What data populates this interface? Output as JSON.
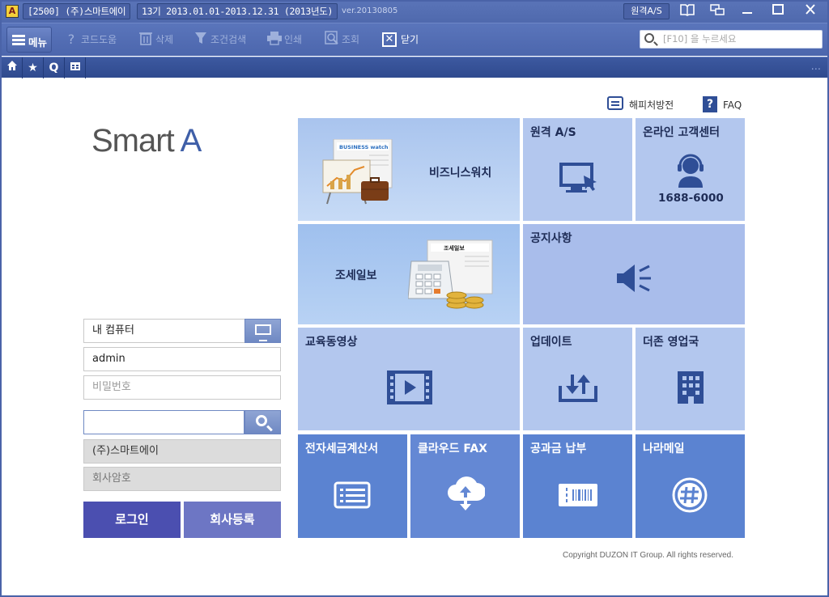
{
  "titlebar": {
    "app_icon": "A",
    "code_company": "[2500] (주)스마트에이",
    "period": "13기 2013.01.01-2013.12.31 (2013년도)",
    "version": "ver.20130805",
    "remote": "원격A/S",
    "controls": [
      "book-icon",
      "windows-icon",
      "minimize-icon",
      "maximize-icon",
      "close-icon"
    ]
  },
  "toolbar": {
    "menu": "메뉴",
    "code_help": "코드도움",
    "delete": "삭제",
    "condition_search": "조건검색",
    "print": "인쇄",
    "inquiry": "조회",
    "close": "닫기",
    "search_placeholder": "[F10] 을 누르세요"
  },
  "nav": {
    "icons": [
      "home-icon",
      "star-icon",
      "q-icon",
      "calendar-icon"
    ],
    "more": "..."
  },
  "links": {
    "happy_call": "해피처방전",
    "faq": "FAQ"
  },
  "logo": {
    "smart": "Smart ",
    "a": "A"
  },
  "login": {
    "computer": "내 컴퓨터",
    "user_id": "admin",
    "password_placeholder": "비밀번호",
    "search_value": "",
    "company": "(주)스마트에이",
    "company_pw_placeholder": "회사암호",
    "login_button": "로그인",
    "register_button": "회사등록"
  },
  "tiles": {
    "business_watch": "비즈니스워치",
    "remote_as": "원격 A/S",
    "customer_center": "온라인 고객센터",
    "customer_phone": "1688-6000",
    "tax_daily": "조세일보",
    "notice": "공지사항",
    "edu_video": "교육동영상",
    "update": "업데이트",
    "duzon_sales": "더존 영업국",
    "e_tax_invoice": "전자세금계산서",
    "cloud_fax": "클라우드 FAX",
    "public_payment": "공과금 납부",
    "nara_mail": "나라메일",
    "bw_paper_label": "BUSINESS watch",
    "tax_paper_label": "조세일보"
  },
  "colors": {
    "titlebar": "#5a74b8",
    "nav": "#2f4a8e",
    "tile_light": "#b3c7ee",
    "tile_dark": "#5b83d1",
    "login_button": "#4b4fb0"
  },
  "copyright": "Copyright DUZON IT Group. All rights reserved."
}
